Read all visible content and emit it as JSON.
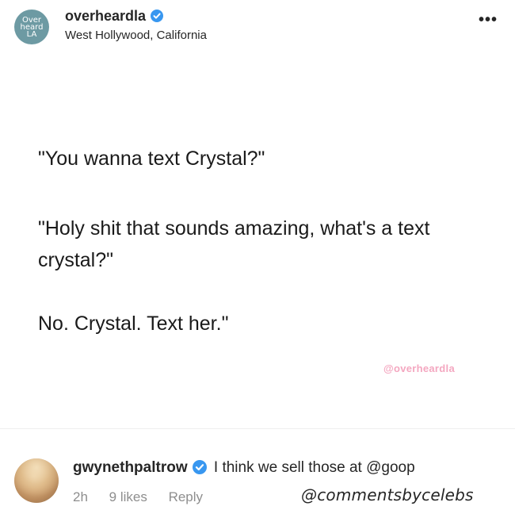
{
  "header": {
    "avatar_lines": [
      "Over",
      "heard",
      "LA"
    ],
    "username": "overheardla",
    "location": "West Hollywood, California",
    "more_icon": "more-horizontal-icon"
  },
  "post": {
    "line1": "\"You wanna text Crystal?\"",
    "line2": "\"Holy shit that sounds amazing, what's a text crystal?\"",
    "line3": "No. Crystal. Text her.\"",
    "watermark": "@overheardla"
  },
  "comment": {
    "username": "gwynethpaltrow",
    "text": "I think we sell those at @goop",
    "time": "2h",
    "likes": "9 likes",
    "reply_label": "Reply",
    "credit": "@commentsbycelebs"
  },
  "colors": {
    "verified": "#3897f0",
    "avatar_bg": "#6d9aa3",
    "watermark": "#f4a7c0",
    "meta": "#8e8e8e"
  }
}
